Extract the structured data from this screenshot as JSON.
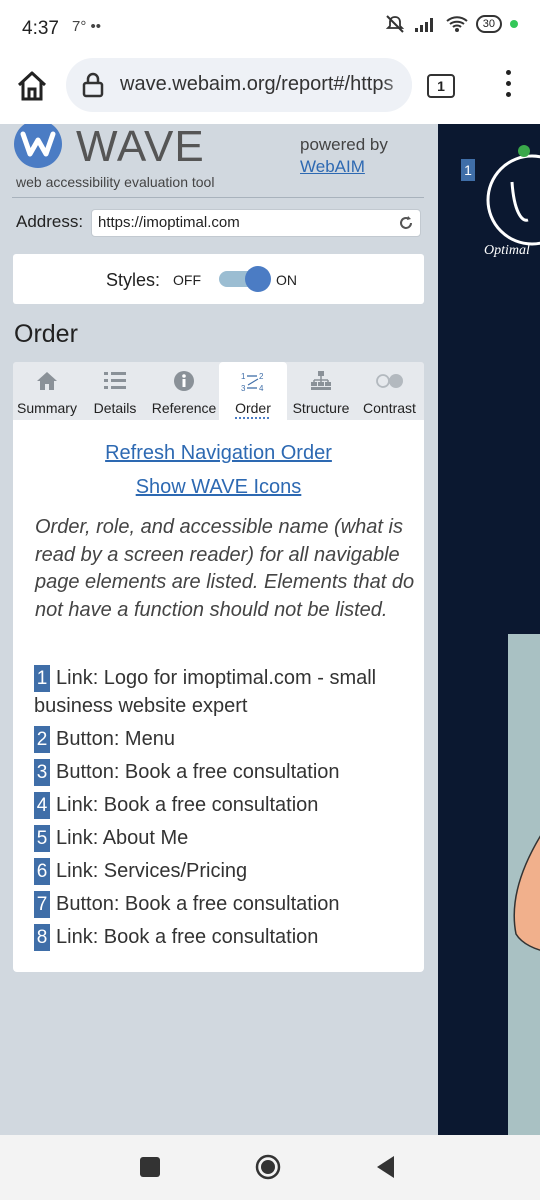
{
  "status_bar": {
    "time": "4:37",
    "extra": "7° ••",
    "battery": "30"
  },
  "browser": {
    "url": "wave.webaim.org/report#/https",
    "tab_count": "1"
  },
  "wave": {
    "title": "WAVE",
    "subtitle": "web accessibility evaluation tool",
    "powered_by": "powered by",
    "webaim_link": "WebAIM",
    "address_label": "Address:",
    "address_value": "https://imoptimal.com",
    "styles_label": "Styles:",
    "styles_off": "OFF",
    "styles_on": "ON",
    "styles_enabled": true,
    "section_heading": "Order",
    "tabs": [
      {
        "label": "Summary",
        "icon": "home-icon"
      },
      {
        "label": "Details",
        "icon": "list-icon"
      },
      {
        "label": "Reference",
        "icon": "info-icon"
      },
      {
        "label": "Order",
        "icon": "order-icon",
        "active": true
      },
      {
        "label": "Structure",
        "icon": "structure-icon"
      },
      {
        "label": "Contrast",
        "icon": "contrast-icon"
      }
    ],
    "refresh_link": "Refresh Navigation Order",
    "icons_link": "Show WAVE Icons",
    "description": "Order, role, and accessible name (what is read by a screen reader) for all navigable page elements are listed. Elements that do not have a function should not be listed.",
    "order_items": [
      {
        "num": "1",
        "text": "Link: Logo for imoptimal.com - small business website expert"
      },
      {
        "num": "2",
        "text": "Button: Menu"
      },
      {
        "num": "3",
        "text": "Button: Book a free consultation"
      },
      {
        "num": "4",
        "text": "Link: Book a free consultation"
      },
      {
        "num": "5",
        "text": "Link: About Me"
      },
      {
        "num": "6",
        "text": "Link: Services/Pricing"
      },
      {
        "num": "7",
        "text": "Button: Book a free consultation"
      },
      {
        "num": "8",
        "text": "Link: Book a free consultation"
      }
    ]
  },
  "site_preview": {
    "badge": "1",
    "logo_text": "Optimal"
  },
  "colors": {
    "accent": "#4b7cc4",
    "link": "#2d69b2",
    "sidebar_bg": "#d1d8df",
    "badge_bg": "#3f6ea8",
    "site_bg": "#0b1830"
  }
}
